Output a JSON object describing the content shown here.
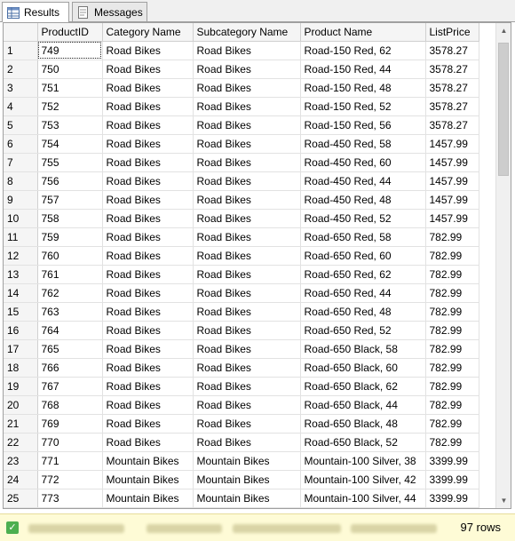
{
  "tabs": [
    {
      "label": "Results",
      "icon": "grid-icon",
      "active": true
    },
    {
      "label": "Messages",
      "icon": "messages-icon",
      "active": false
    }
  ],
  "columns": [
    "ProductID",
    "Category Name",
    "Subcategory Name",
    "Product Name",
    "ListPrice"
  ],
  "rows": [
    [
      "1",
      "749",
      "Road Bikes",
      "Road Bikes",
      "Road-150 Red, 62",
      "3578.27"
    ],
    [
      "2",
      "750",
      "Road Bikes",
      "Road Bikes",
      "Road-150 Red, 44",
      "3578.27"
    ],
    [
      "3",
      "751",
      "Road Bikes",
      "Road Bikes",
      "Road-150 Red, 48",
      "3578.27"
    ],
    [
      "4",
      "752",
      "Road Bikes",
      "Road Bikes",
      "Road-150 Red, 52",
      "3578.27"
    ],
    [
      "5",
      "753",
      "Road Bikes",
      "Road Bikes",
      "Road-150 Red, 56",
      "3578.27"
    ],
    [
      "6",
      "754",
      "Road Bikes",
      "Road Bikes",
      "Road-450 Red, 58",
      "1457.99"
    ],
    [
      "7",
      "755",
      "Road Bikes",
      "Road Bikes",
      "Road-450 Red, 60",
      "1457.99"
    ],
    [
      "8",
      "756",
      "Road Bikes",
      "Road Bikes",
      "Road-450 Red, 44",
      "1457.99"
    ],
    [
      "9",
      "757",
      "Road Bikes",
      "Road Bikes",
      "Road-450 Red, 48",
      "1457.99"
    ],
    [
      "10",
      "758",
      "Road Bikes",
      "Road Bikes",
      "Road-450 Red, 52",
      "1457.99"
    ],
    [
      "11",
      "759",
      "Road Bikes",
      "Road Bikes",
      "Road-650 Red, 58",
      "782.99"
    ],
    [
      "12",
      "760",
      "Road Bikes",
      "Road Bikes",
      "Road-650 Red, 60",
      "782.99"
    ],
    [
      "13",
      "761",
      "Road Bikes",
      "Road Bikes",
      "Road-650 Red, 62",
      "782.99"
    ],
    [
      "14",
      "762",
      "Road Bikes",
      "Road Bikes",
      "Road-650 Red, 44",
      "782.99"
    ],
    [
      "15",
      "763",
      "Road Bikes",
      "Road Bikes",
      "Road-650 Red, 48",
      "782.99"
    ],
    [
      "16",
      "764",
      "Road Bikes",
      "Road Bikes",
      "Road-650 Red, 52",
      "782.99"
    ],
    [
      "17",
      "765",
      "Road Bikes",
      "Road Bikes",
      "Road-650 Black, 58",
      "782.99"
    ],
    [
      "18",
      "766",
      "Road Bikes",
      "Road Bikes",
      "Road-650 Black, 60",
      "782.99"
    ],
    [
      "19",
      "767",
      "Road Bikes",
      "Road Bikes",
      "Road-650 Black, 62",
      "782.99"
    ],
    [
      "20",
      "768",
      "Road Bikes",
      "Road Bikes",
      "Road-650 Black, 44",
      "782.99"
    ],
    [
      "21",
      "769",
      "Road Bikes",
      "Road Bikes",
      "Road-650 Black, 48",
      "782.99"
    ],
    [
      "22",
      "770",
      "Road Bikes",
      "Road Bikes",
      "Road-650 Black, 52",
      "782.99"
    ],
    [
      "23",
      "771",
      "Mountain Bikes",
      "Mountain Bikes",
      "Mountain-100 Silver, 38",
      "3399.99"
    ],
    [
      "24",
      "772",
      "Mountain Bikes",
      "Mountain Bikes",
      "Mountain-100 Silver, 42",
      "3399.99"
    ],
    [
      "25",
      "773",
      "Mountain Bikes",
      "Mountain Bikes",
      "Mountain-100 Silver, 44",
      "3399.99"
    ]
  ],
  "status": {
    "icon": "query-success-icon",
    "row_count": "97 rows",
    "background": "#fefbd6"
  }
}
